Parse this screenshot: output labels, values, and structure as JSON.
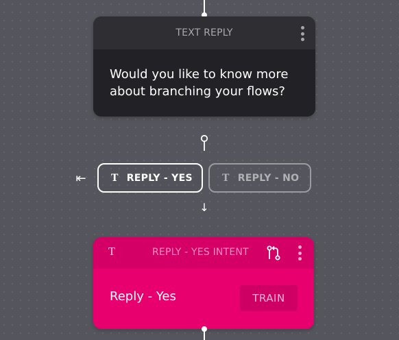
{
  "text_reply": {
    "header_title": "TEXT REPLY",
    "message": "Would you like to know more about branching your flows?",
    "menu_icon": "kebab-menu-icon"
  },
  "quick_replies": [
    {
      "icon": "T",
      "label": "REPLY - YES",
      "state": "selected"
    },
    {
      "icon": "T",
      "label": "REPLY - NO",
      "state": "unselected"
    }
  ],
  "arrows": {
    "back": "⇤",
    "down": "↓"
  },
  "intent": {
    "icon": "T",
    "header_title": "REPLY - YES INTENT",
    "branch_icon": "branch-icon",
    "label": "Reply - Yes",
    "train_label": "TRAIN"
  },
  "colors": {
    "canvas": "#55565d",
    "text_card_header": "#2f2f33",
    "text_card_body": "#222226",
    "intent_header": "#d40065",
    "intent_body": "#e8006e",
    "train_button": "#cf0063"
  }
}
